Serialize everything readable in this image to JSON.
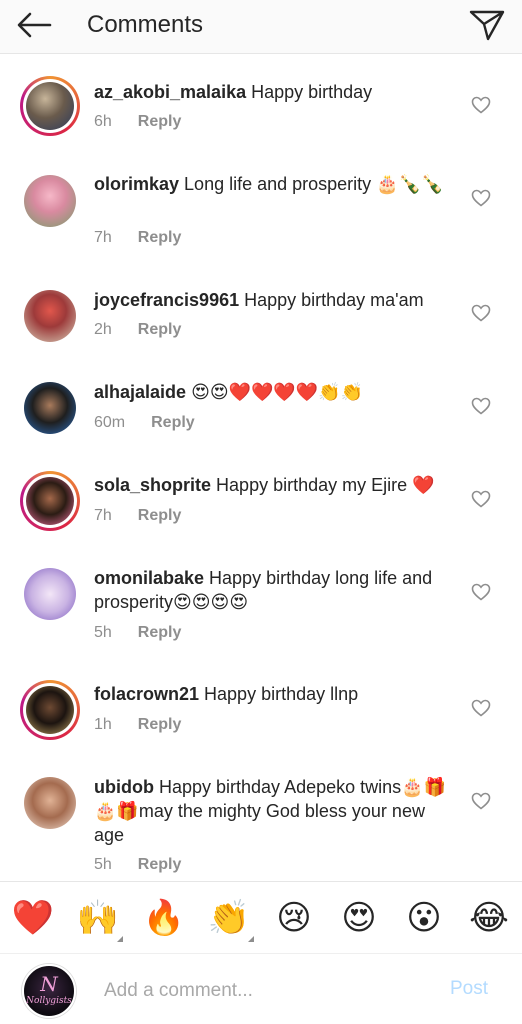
{
  "header": {
    "title": "Comments",
    "back_icon": "arrow-left-icon",
    "send_icon": "paper-plane-icon"
  },
  "comments": [
    {
      "username": "az_akobi_malaika",
      "text": " Happy birthday",
      "time": "6h",
      "reply": "Reply"
    },
    {
      "username": "olorimkay",
      "text": " Long life and prosperity 🎂🍾🍾",
      "time": "7h",
      "reply": "Reply"
    },
    {
      "username": "joycefrancis9961",
      "text": " Happy birthday ma'am",
      "time": "2h",
      "reply": "Reply"
    },
    {
      "username": "alhajalaide",
      "text": " 😍😍❤️❤️❤️❤️👏👏",
      "time": "60m",
      "reply": "Reply"
    },
    {
      "username": "sola_shoprite",
      "text": " Happy birthday my Ejire ❤️",
      "time": "7h",
      "reply": "Reply"
    },
    {
      "username": "omonilabake",
      "text": " Happy birthday long life and prosperity😍😍😍😍",
      "time": "5h",
      "reply": "Reply"
    },
    {
      "username": "folacrown21",
      "text": " Happy birthday llnp",
      "time": "1h",
      "reply": "Reply"
    },
    {
      "username": "ubidob",
      "text": " Happy birthday Adepeko twins🎂🎁🎂🎁may the mighty God bless your new age",
      "time": "5h",
      "reply": "Reply"
    }
  ],
  "reactions": [
    "❤️",
    "🙌",
    "🔥",
    "👏",
    "😢",
    "😍",
    "😮",
    "😂"
  ],
  "composer": {
    "avatar_text": "Nollygists",
    "avatar_mark": "N",
    "placeholder": "Add a comment...",
    "post_label": "Post"
  },
  "colors": {
    "text": "#262626",
    "muted": "#8e8e8e",
    "post_disabled": "#b3dbff",
    "story_ring": "#dc2743"
  }
}
